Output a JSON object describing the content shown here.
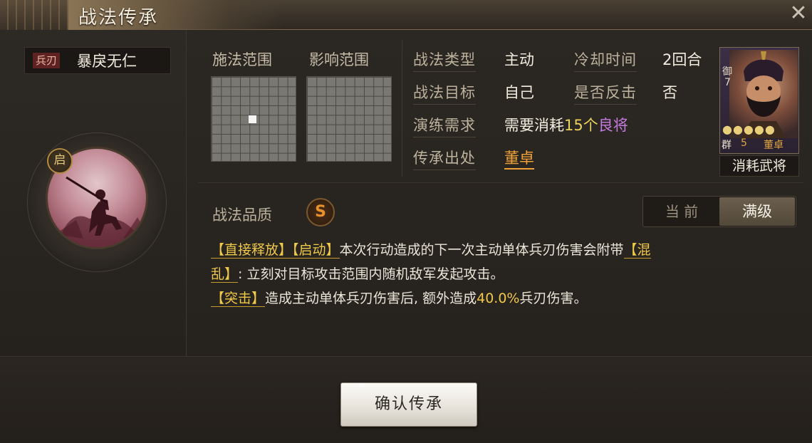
{
  "window": {
    "title": "战法传承",
    "close_icon": "close-icon"
  },
  "skill": {
    "troop_tag": "兵刃",
    "name": "暴戾无仁",
    "start_badge": "启"
  },
  "range": {
    "cast_label": "施法范围",
    "effect_label": "影响范围",
    "grid_size": 9
  },
  "info": {
    "type_label": "战法类型",
    "type_value": "主动",
    "cooldown_label": "冷却时间",
    "cooldown_value": "2回合",
    "target_label": "战法目标",
    "target_value": "自己",
    "counter_label": "是否反击",
    "counter_value": "否",
    "require_label": "演练需求",
    "require_prefix": "需要消耗",
    "require_count": "15个",
    "require_rank": "良将",
    "origin_label": "传承出处",
    "origin_value": "董卓"
  },
  "general_card": {
    "rank_char": "御",
    "rank_num": "7",
    "stars": "●●●●●",
    "faction": "群",
    "cost": "5",
    "name": "董卓",
    "caption": "消耗武将"
  },
  "quality": {
    "label": "战法品质",
    "grade": "S"
  },
  "level_toggle": {
    "current": "当 前",
    "max": "满级"
  },
  "description": {
    "line1_kw1": "【直接释放】",
    "line1_kw2": "【启动】",
    "line1_text": "本次行动造成的下一次主动单体兵刃伤害会附带",
    "line1_kw3": "【混",
    "line2_kw": "乱】",
    "line2_text": ": 立刻对目标攻击范围内随机敌军发起攻击。",
    "line3_kw": "【突击】",
    "line3_text_a": "造成主动单体兵刃伤害后, 额外造成",
    "line3_num": "40.0%",
    "line3_text_b": "兵刃伤害。"
  },
  "confirm_button": "确认传承",
  "colors": {
    "accent_gold": "#ecd35e",
    "accent_purple": "#c77ae0",
    "link_orange": "#f0a23a",
    "quality_orange": "#e8922b"
  }
}
